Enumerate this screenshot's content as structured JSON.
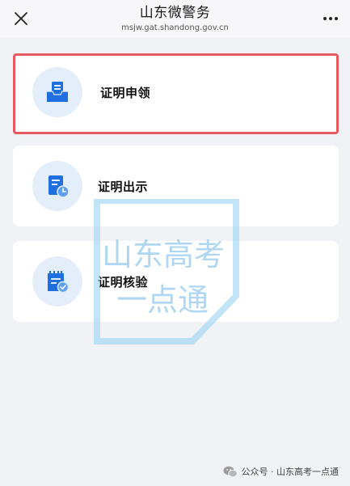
{
  "header": {
    "title": "山东微警务",
    "subtitle": "msjw.gat.shandong.gov.cn"
  },
  "cards": [
    {
      "label": "证明申领",
      "icon": "inbox-document-icon",
      "selected": true
    },
    {
      "label": "证明出示",
      "icon": "document-clock-icon",
      "selected": false
    },
    {
      "label": "证明核验",
      "icon": "calendar-check-icon",
      "selected": false
    }
  ],
  "watermark": {
    "line1": "山东高考",
    "line2": "一点通"
  },
  "footer": {
    "text": "公众号 · 山东高考一点通"
  },
  "colors": {
    "accent": "#1f6fe0",
    "icon_bg": "#e4eefa",
    "highlight_border": "#e45a5f",
    "page_bg": "#f1f2f6"
  }
}
